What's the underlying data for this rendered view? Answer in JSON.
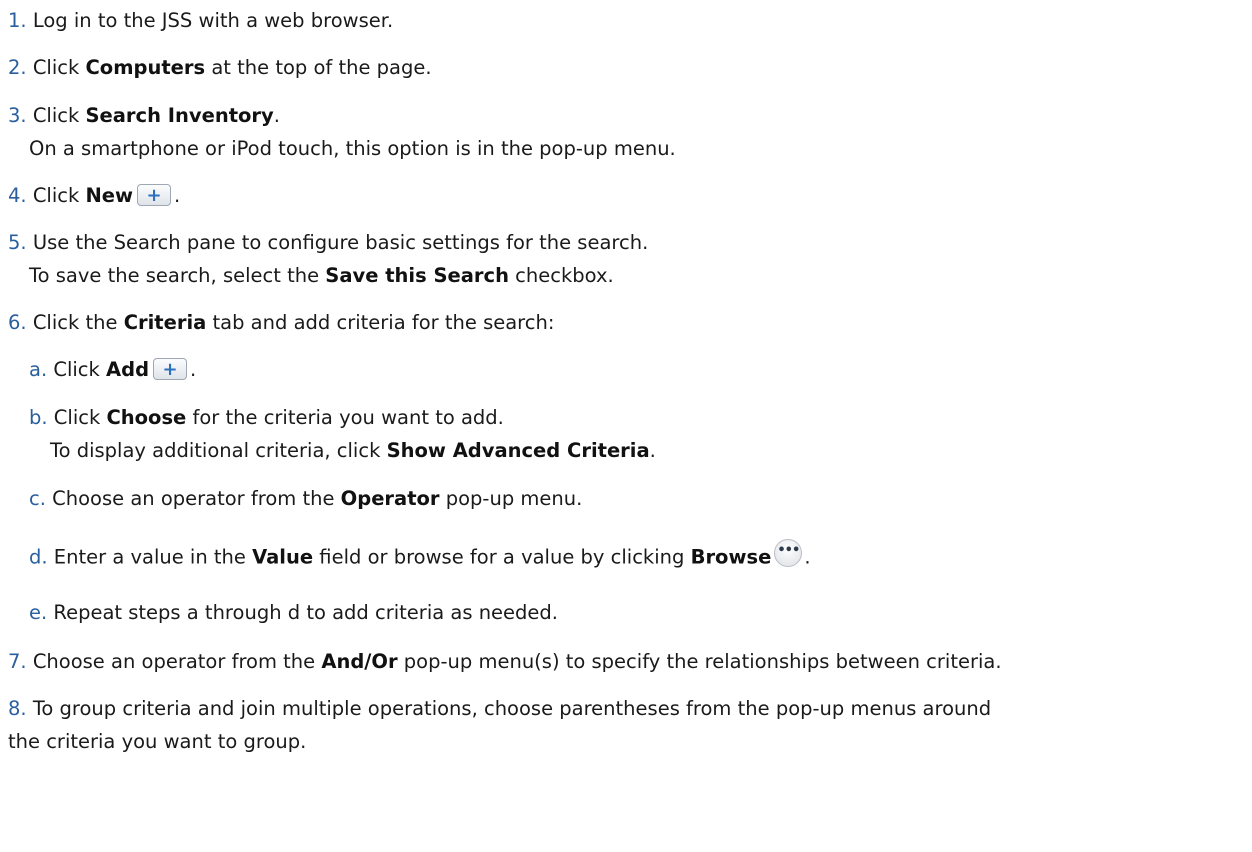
{
  "steps": [
    {
      "num": "1.",
      "pre": "Log in to the JSS with a web browser."
    },
    {
      "num": "2.",
      "pre": "Click ",
      "bold": "Computers",
      "post": " at the top of the page."
    },
    {
      "num": "3.",
      "pre": "Click ",
      "bold": "Search Inventory",
      "post": ".",
      "line2": "On a smartphone or iPod touch, this option is in the pop-up menu."
    },
    {
      "num": "4.",
      "pre": "Click ",
      "bold": "New",
      "post": "."
    },
    {
      "num": "5.",
      "pre": "Use the Search pane to configure basic settings for the search.",
      "line2_pre": "To save the search, select the ",
      "line2_bold": "Save this Search",
      "line2_post": " checkbox."
    },
    {
      "num": "6.",
      "pre": "Click the ",
      "bold": "Criteria",
      "post": " tab and add criteria for the search:"
    },
    {
      "num": "7.",
      "pre": "Choose an operator from the ",
      "bold": "And/Or",
      "post": " pop-up menu(s) to specify the relationships between criteria."
    },
    {
      "num": "8.",
      "pre": "To group criteria and join multiple operations, choose parentheses from the pop-up menus around",
      "line2": "the criteria you want to group."
    }
  ],
  "substeps": [
    {
      "num": "a.",
      "pre": "Click ",
      "bold": "Add",
      "post": "."
    },
    {
      "num": "b.",
      "pre": "Click ",
      "bold": "Choose",
      "post": " for the criteria you want to add.",
      "line2_pre": "To display additional criteria, click ",
      "line2_bold": "Show Advanced Criteria",
      "line2_post": "."
    },
    {
      "num": "c.",
      "pre": "Choose an operator from the ",
      "bold": "Operator",
      "post": " pop-up menu."
    },
    {
      "num": "d.",
      "pre": "Enter a value in the ",
      "bold": "Value",
      "mid": " field or browse for a value by clicking ",
      "bold2": "Browse",
      "post": "."
    },
    {
      "num": "e.",
      "pre": "Repeat steps a through d to add criteria as needed."
    }
  ],
  "icons": {
    "plus_glyph": "+",
    "browse_glyph": "•••"
  }
}
